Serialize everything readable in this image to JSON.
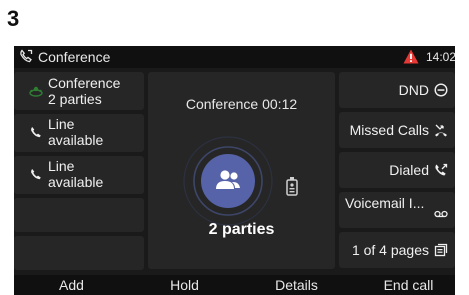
{
  "step_number": "3",
  "status_bar": {
    "title": "Conference",
    "time": "14:02",
    "icons": {
      "call": "phone-handset-icon",
      "alert": "warning-triangle-icon"
    },
    "alert_color": "#e53935"
  },
  "left_keys": [
    {
      "line1": "Conference",
      "line2": "2 parties",
      "icon": "conference-phone-icon",
      "icon_color": "#2e7d32"
    },
    {
      "line1": "Line",
      "line2": "available",
      "icon": "phone-handset-icon"
    },
    {
      "line1": "Line",
      "line2": "available",
      "icon": "phone-handset-icon"
    },
    {
      "line1": "",
      "line2": ""
    },
    {
      "line1": "",
      "line2": ""
    }
  ],
  "center": {
    "title": "Conference 00:12",
    "parties_label": "2 parties",
    "avatar_icon": "group-icon",
    "avatar_color": "#5763a8",
    "recorder_icon": "recorder-icon"
  },
  "right_keys": [
    {
      "label": "DND",
      "icon": "do-not-disturb-icon"
    },
    {
      "label": "Missed Calls",
      "icon": "missed-calls-icon"
    },
    {
      "label": "Dialed",
      "icon": "dialed-calls-icon"
    },
    {
      "label": "Voicemail I...",
      "icon": "voicemail-icon"
    },
    {
      "label": "1 of 4 pages",
      "icon": "pages-icon"
    }
  ],
  "softkeys": [
    "Add",
    "Hold",
    "Details",
    "End call"
  ]
}
